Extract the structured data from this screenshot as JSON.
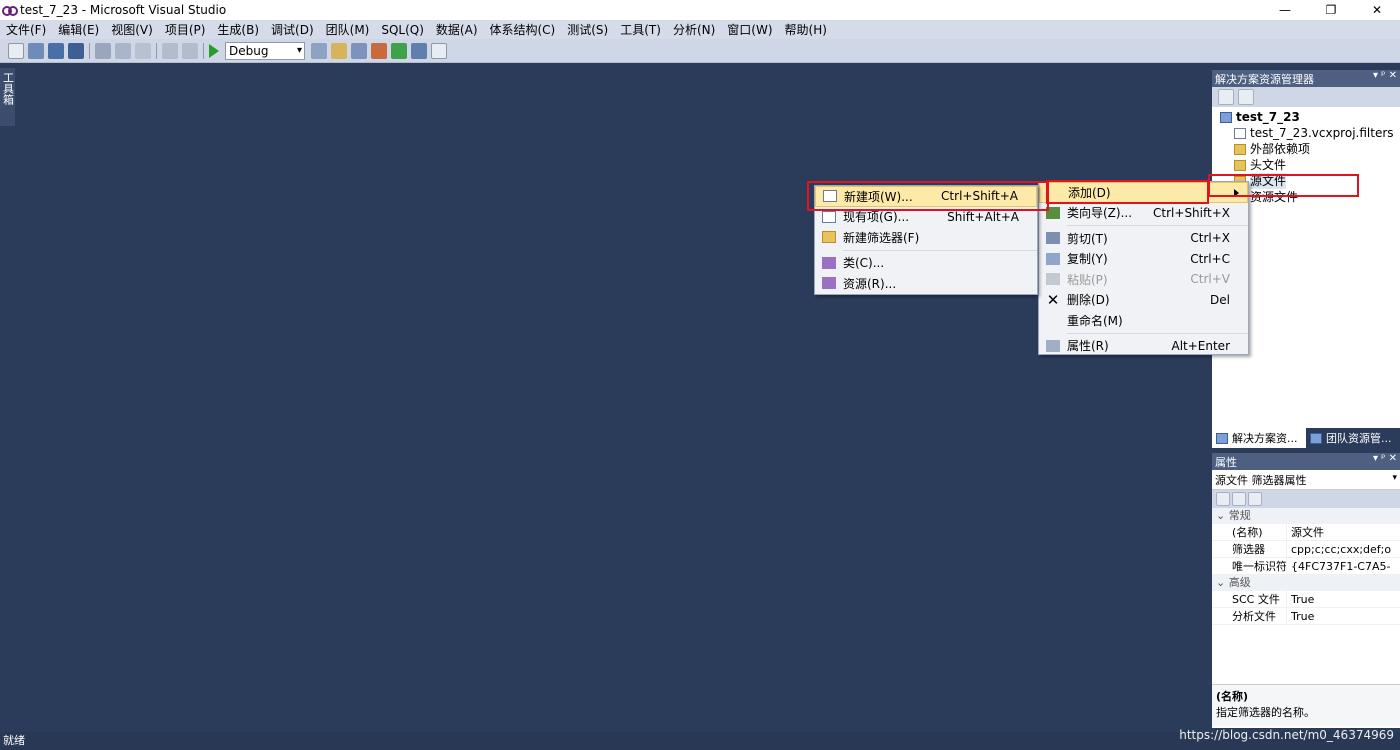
{
  "window": {
    "title": "test_7_23 - Microsoft Visual Studio",
    "minimize": "—",
    "restore": "❐",
    "close": "✕"
  },
  "menubar": [
    "文件(F)",
    "编辑(E)",
    "视图(V)",
    "项目(P)",
    "生成(B)",
    "调试(D)",
    "团队(M)",
    "SQL(Q)",
    "数据(A)",
    "体系结构(C)",
    "测试(S)",
    "工具(T)",
    "分析(N)",
    "窗口(W)",
    "帮助(H)"
  ],
  "toolbar": {
    "config": "Debug"
  },
  "toolbox": {
    "label": "工具箱"
  },
  "solution_explorer": {
    "title": "解决方案资源管理器",
    "pin": "▾ ᵖ ✕",
    "project": "test_7_23",
    "items": [
      "test_7_23.vcxproj.filters",
      "外部依赖项",
      "头文件",
      "源文件",
      "资源文件"
    ]
  },
  "panel_tabs": [
    "解决方案资...",
    "团队资源管..."
  ],
  "properties": {
    "title": "属性",
    "selector": "源文件 筛选器属性",
    "categories": [
      "常规",
      "高级"
    ],
    "rows_general": [
      [
        "(名称)",
        "源文件"
      ],
      [
        "筛选器",
        "cpp;c;cc;cxx;def;o"
      ],
      [
        "唯一标识符",
        "{4FC737F1-C7A5-"
      ]
    ],
    "rows_advanced": [
      [
        "SCC 文件",
        "True"
      ],
      [
        "分析文件",
        "True"
      ]
    ],
    "desc_title": "(名称)",
    "desc_text": "指定筛选器的名称。"
  },
  "context_menu": [
    {
      "label": "添加(D)",
      "shortcut": "",
      "icon": "",
      "highlight": true
    },
    {
      "label": "类向导(Z)...",
      "shortcut": "Ctrl+Shift+X",
      "icon": "class-wizard-icon"
    },
    {
      "label": "剪切(T)",
      "shortcut": "Ctrl+X",
      "icon": "cut-icon"
    },
    {
      "label": "复制(Y)",
      "shortcut": "Ctrl+C",
      "icon": "copy-icon"
    },
    {
      "label": "粘贴(P)",
      "shortcut": "Ctrl+V",
      "icon": "paste-icon",
      "disabled": true
    },
    {
      "label": "删除(D)",
      "shortcut": "Del",
      "icon": "delete-icon"
    },
    {
      "label": "重命名(M)",
      "shortcut": "",
      "icon": ""
    },
    {
      "label": "属性(R)",
      "shortcut": "Alt+Enter",
      "icon": "properties-icon"
    }
  ],
  "submenu": [
    {
      "label": "新建项(W)...",
      "shortcut": "Ctrl+Shift+A",
      "icon": "new-item-icon",
      "highlight": true
    },
    {
      "label": "现有项(G)...",
      "shortcut": "Shift+Alt+A",
      "icon": "existing-item-icon"
    },
    {
      "label": "新建筛选器(F)",
      "shortcut": "",
      "icon": "new-filter-icon"
    },
    {
      "label": "类(C)...",
      "shortcut": "",
      "icon": "class-icon"
    },
    {
      "label": "资源(R)...",
      "shortcut": "",
      "icon": "resource-icon"
    }
  ],
  "status": "就绪",
  "watermark": "https://blog.csdn.net/m0_46374969",
  "colors": {
    "background": "#2b3c5a",
    "highlight": "#fde9a8",
    "annotation": "#e0141e"
  }
}
